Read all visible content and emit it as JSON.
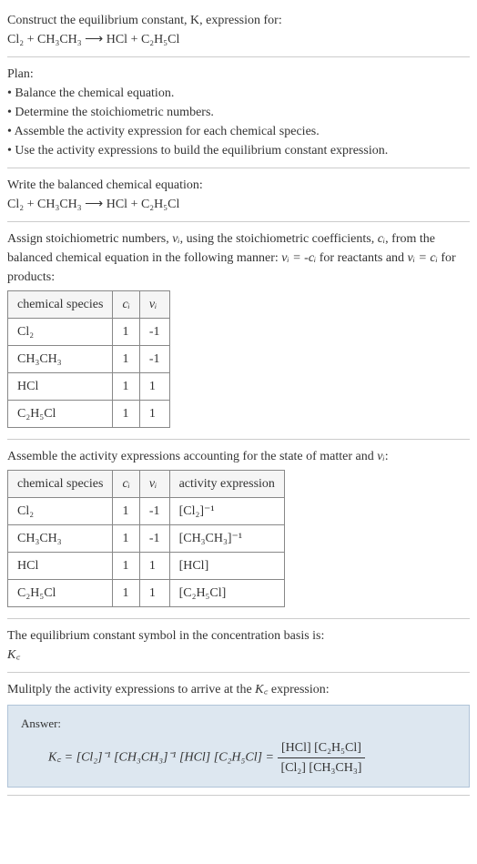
{
  "prompt": {
    "line1": "Construct the equilibrium constant, K, expression for:",
    "equation": "Cl₂ + CH₃CH₃ ⟶ HCl + C₂H₅Cl"
  },
  "plan": {
    "title": "Plan:",
    "item1": "• Balance the chemical equation.",
    "item2": "• Determine the stoichiometric numbers.",
    "item3": "• Assemble the activity expression for each chemical species.",
    "item4": "• Use the activity expressions to build the equilibrium constant expression."
  },
  "balanced": {
    "title": "Write the balanced chemical equation:",
    "equation": "Cl₂ + CH₃CH₃ ⟶ HCl + C₂H₅Cl"
  },
  "stoich": {
    "intro_pre": "Assign stoichiometric numbers, ",
    "nu_i": "νᵢ",
    "intro_mid1": ", using the stoichiometric coefficients, ",
    "c_i": "cᵢ",
    "intro_mid2": ", from the balanced chemical equation in the following manner: ",
    "eq1": "νᵢ = -cᵢ",
    "intro_mid3": " for reactants and ",
    "eq2": "νᵢ = cᵢ",
    "intro_end": " for products:",
    "headers": {
      "h1": "chemical species",
      "h2": "cᵢ",
      "h3": "νᵢ"
    },
    "rows": [
      {
        "sp": "Cl₂",
        "c": "1",
        "nu": "-1"
      },
      {
        "sp": "CH₃CH₃",
        "c": "1",
        "nu": "-1"
      },
      {
        "sp": "HCl",
        "c": "1",
        "nu": "1"
      },
      {
        "sp": "C₂H₅Cl",
        "c": "1",
        "nu": "1"
      }
    ]
  },
  "activity": {
    "title_pre": "Assemble the activity expressions accounting for the state of matter and ",
    "title_nu": "νᵢ",
    "title_end": ":",
    "headers": {
      "h1": "chemical species",
      "h2": "cᵢ",
      "h3": "νᵢ",
      "h4": "activity expression"
    },
    "rows": [
      {
        "sp": "Cl₂",
        "c": "1",
        "nu": "-1",
        "ae": "[Cl₂]⁻¹"
      },
      {
        "sp": "CH₃CH₃",
        "c": "1",
        "nu": "-1",
        "ae": "[CH₃CH₃]⁻¹"
      },
      {
        "sp": "HCl",
        "c": "1",
        "nu": "1",
        "ae": "[HCl]"
      },
      {
        "sp": "C₂H₅Cl",
        "c": "1",
        "nu": "1",
        "ae": "[C₂H₅Cl]"
      }
    ]
  },
  "symbol": {
    "title": "The equilibrium constant symbol in the concentration basis is:",
    "kc": "K꜀"
  },
  "final": {
    "title_pre": "Mulitply the activity expressions to arrive at the ",
    "kc": "K꜀",
    "title_end": " expression:",
    "answer_label": "Answer:",
    "expr": "K꜀ = [Cl₂]⁻¹ [CH₃CH₃]⁻¹ [HCl] [C₂H₅Cl] = ",
    "num": "[HCl] [C₂H₅Cl]",
    "den": "[Cl₂] [CH₃CH₃]"
  }
}
